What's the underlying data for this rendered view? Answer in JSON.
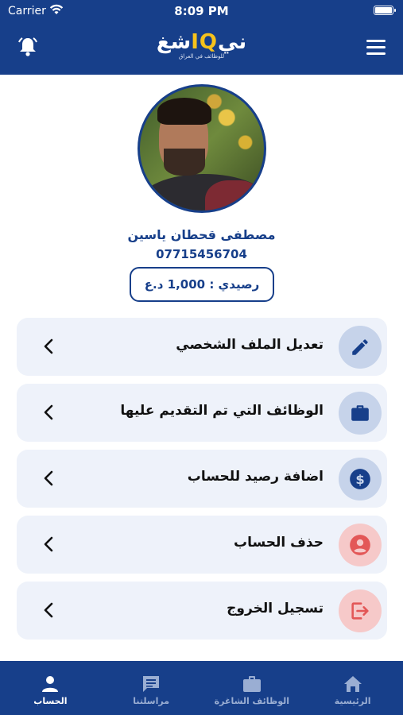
{
  "status_bar": {
    "carrier": "Carrier",
    "time": "8:09 PM",
    "battery_level": 0.9
  },
  "header": {
    "logo_main": "شغ",
    "logo_q": "IQ",
    "logo_end": "ني",
    "logo_tagline": "للوظائف في العراق"
  },
  "profile": {
    "name": "مصطفى قحطان ياسين",
    "phone": "07715456704",
    "balance": "رصيدي : 1,000 د.ع"
  },
  "menu": [
    {
      "label": "تعديل الملف الشخصي",
      "icon": "edit-icon"
    },
    {
      "label": "الوظائف التي تم التقديم عليها",
      "icon": "briefcase-icon"
    },
    {
      "label": "اضافة رصيد للحساب",
      "icon": "dollar-icon"
    },
    {
      "label": "حذف الحساب",
      "icon": "delete-account-icon"
    },
    {
      "label": "تسجيل الخروج",
      "icon": "logout-icon"
    }
  ],
  "tabs": [
    {
      "label": "الحساب",
      "icon": "person-icon",
      "active": true
    },
    {
      "label": "مراسلتنا",
      "icon": "message-icon",
      "active": false
    },
    {
      "label": "الوظائف الشاغرة",
      "icon": "briefcase-icon",
      "active": false
    },
    {
      "label": "الرئيسية",
      "icon": "home-icon",
      "active": false
    }
  ],
  "colors": {
    "primary": "#173f8a",
    "accent": "#f6c21b",
    "card_bg": "#eef2fa",
    "danger": "#e35757"
  }
}
